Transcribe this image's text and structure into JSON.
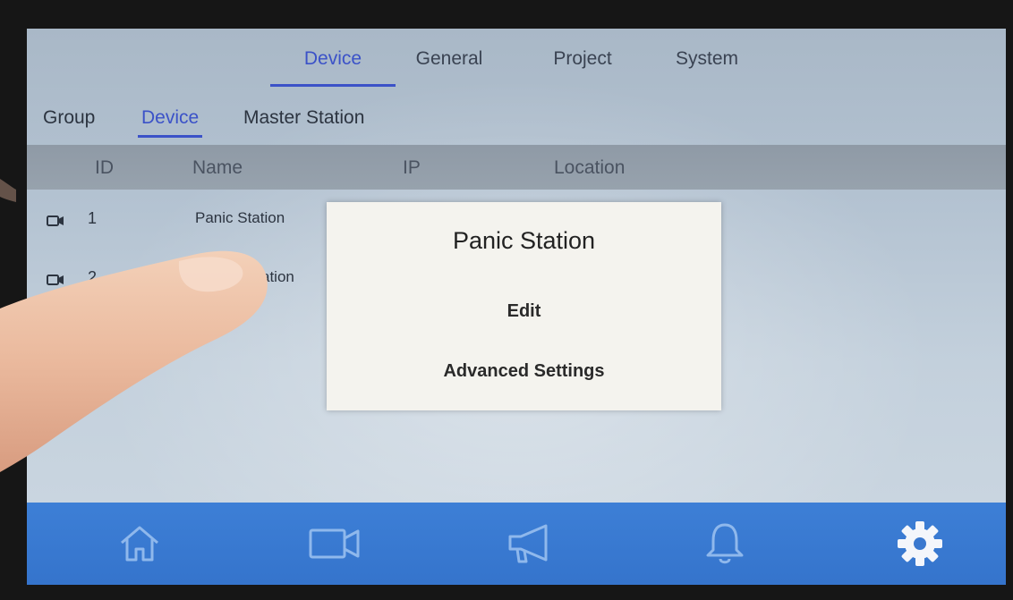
{
  "top_tabs": [
    {
      "label": "Device",
      "active": true
    },
    {
      "label": "General",
      "active": false
    },
    {
      "label": "Project",
      "active": false
    },
    {
      "label": "System",
      "active": false
    }
  ],
  "sub_tabs": [
    {
      "label": "Group",
      "active": false
    },
    {
      "label": "Device",
      "active": true
    },
    {
      "label": "Master Station",
      "active": false
    }
  ],
  "table": {
    "headers": [
      "ID",
      "Name",
      "IP",
      "Location"
    ],
    "rows": [
      {
        "id": "1",
        "name": "Panic Station",
        "icon": "camera-icon"
      },
      {
        "id": "2",
        "name": "ation",
        "icon": "camera-icon"
      }
    ]
  },
  "dialog": {
    "title": "Panic Station",
    "options": [
      "Edit",
      "Advanced Settings"
    ]
  },
  "bottom_nav": [
    {
      "icon": "home-icon",
      "active": false
    },
    {
      "icon": "camera-icon",
      "active": false
    },
    {
      "icon": "megaphone-icon",
      "active": false
    },
    {
      "icon": "bell-icon",
      "active": false
    },
    {
      "icon": "gear-icon",
      "active": true
    }
  ],
  "colors": {
    "accent": "#3b52c8",
    "nav_bar": "#3a7bd4",
    "dialog_bg": "#f4f3ee"
  }
}
